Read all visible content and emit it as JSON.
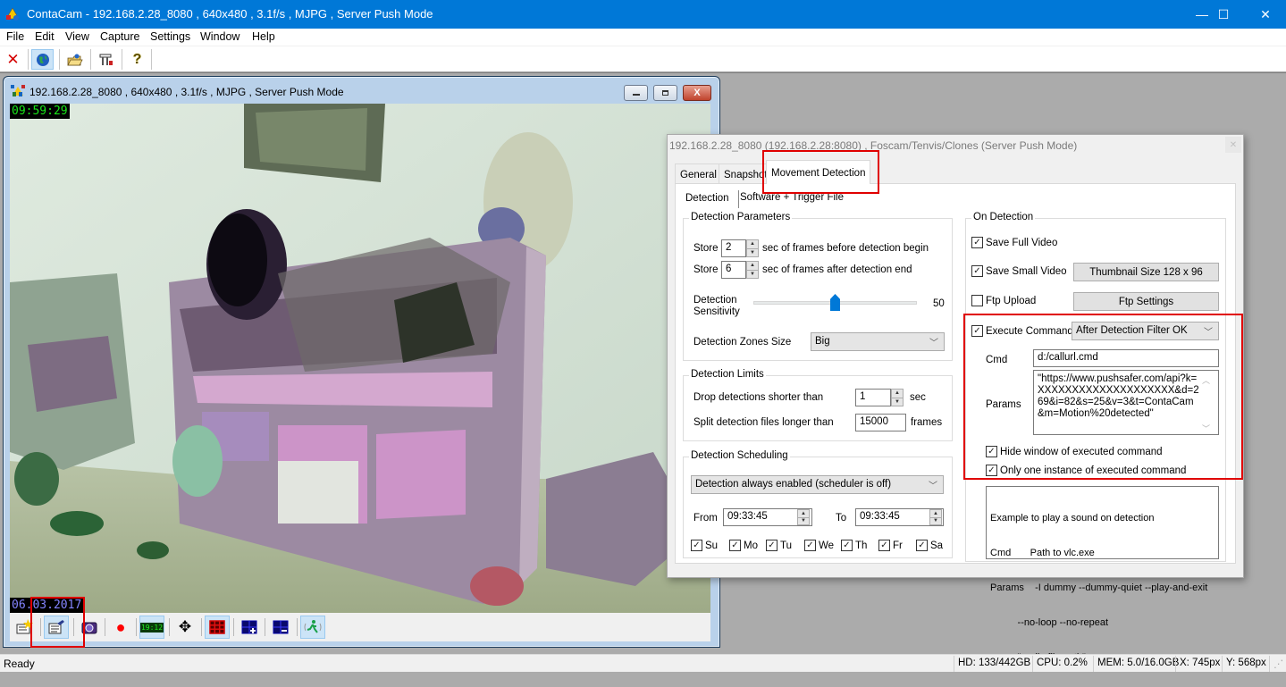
{
  "window": {
    "title": "ContaCam - 192.168.2.28_8080 , 640x480 , 3.1f/s , MJPG , Server Push Mode",
    "controls": {
      "minimize": "—",
      "maximize": "☐",
      "close": "✕"
    }
  },
  "menu": [
    "File",
    "Edit",
    "View",
    "Capture",
    "Settings",
    "Window",
    "Help"
  ],
  "toolbar": [
    {
      "icon": "close-icon",
      "glyph": "✕",
      "color": "#d40000"
    },
    {
      "icon": "globe-icon",
      "glyph": "🌐",
      "active": true
    },
    {
      "icon": "open-folder-icon",
      "glyph": "📂"
    },
    {
      "icon": "network-cameras-icon",
      "glyph": "🖧"
    },
    {
      "icon": "help-icon",
      "glyph": "?"
    }
  ],
  "camera_window": {
    "title": "192.168.2.28_8080 , 640x480 , 3.1f/s , MJPG , Server Push Mode",
    "osd_time": "09:59:29",
    "osd_date": "06.03.2017",
    "toolbar": [
      {
        "icon": "snapshot-wizard-icon",
        "glyph": "✎"
      },
      {
        "icon": "camera-settings-icon",
        "glyph": "🗒",
        "active": true,
        "highlighted": true
      },
      {
        "icon": "camera-snapshot-icon",
        "glyph": "📷"
      },
      {
        "icon": "record-icon",
        "glyph": "●",
        "color": "#ff0000"
      },
      {
        "icon": "timestamp-icon",
        "glyph": "19:12",
        "active": true
      },
      {
        "icon": "fit-window-icon",
        "glyph": "✥"
      },
      {
        "icon": "detection-zones-icon",
        "glyph": "▦",
        "active": true
      },
      {
        "icon": "add-zones-icon",
        "glyph": "+"
      },
      {
        "icon": "remove-zones-icon",
        "glyph": "−"
      },
      {
        "icon": "movement-detection-icon",
        "glyph": "🏃",
        "active": true
      }
    ]
  },
  "dialog": {
    "title": "192.168.2.28_8080 (192.168.2.28:8080) , Foscam/Tenvis/Clones (Server Push Mode)",
    "close_glyph": "✕",
    "tabs": [
      {
        "label": "General",
        "active": false
      },
      {
        "label": "Snapshot",
        "active": false
      },
      {
        "label": "Movement Detection",
        "active": true
      }
    ],
    "detection_label": "Detection",
    "detection_mode": "Software + Trigger File",
    "parameters": {
      "group_title": "Detection Parameters",
      "store_label": "Store",
      "store_before": "2",
      "store_before_suffix": "sec of frames before detection begin",
      "store_after": "6",
      "store_after_suffix": "sec of frames after detection end",
      "sensitivity_label_1": "Detection",
      "sensitivity_label_2": "Sensitivity",
      "sensitivity_value": "50",
      "sensitivity_min": 0,
      "sensitivity_max": 100,
      "zones_size_label": "Detection Zones Size",
      "zones_size_value": "Big"
    },
    "limits": {
      "group_title": "Detection Limits",
      "drop_label": "Drop detections shorter than",
      "drop_value": "1",
      "drop_unit": "sec",
      "split_label": "Split detection files longer than",
      "split_value": "15000",
      "split_unit": "frames"
    },
    "scheduling": {
      "group_title": "Detection Scheduling",
      "mode": "Detection always enabled (scheduler is off)",
      "from_label": "From",
      "from_value": "09:33:45",
      "to_label": "To",
      "to_value": "09:33:45",
      "days": [
        {
          "label": "Su",
          "checked": true
        },
        {
          "label": "Mo",
          "checked": true
        },
        {
          "label": "Tu",
          "checked": true
        },
        {
          "label": "We",
          "checked": true
        },
        {
          "label": "Th",
          "checked": true
        },
        {
          "label": "Fr",
          "checked": true
        },
        {
          "label": "Sa",
          "checked": true
        }
      ]
    },
    "on_detection": {
      "group_title": "On Detection",
      "save_full_video": {
        "label": "Save Full Video",
        "checked": true
      },
      "save_small_video": {
        "label": "Save Small Video",
        "checked": true
      },
      "thumbnail_button": "Thumbnail Size 128 x 96",
      "ftp_upload": {
        "label": "Ftp Upload",
        "checked": false
      },
      "ftp_settings_button": "Ftp Settings",
      "execute_command": {
        "label": "Execute Command",
        "checked": true
      },
      "execute_when": "After Detection Filter OK",
      "cmd_label": "Cmd",
      "cmd_value": "d:/callurl.cmd",
      "params_label": "Params",
      "params_value": "\"https://www.pushsafer.com/api?k=XXXXXXXXXXXXXXXXXXXX&d=269&i=82&s=25&v=3&t=ContaCam&m=Motion%20detected\"",
      "hide_window": {
        "label": "Hide window of executed command",
        "checked": true
      },
      "one_instance": {
        "label": "Only one instance of executed command",
        "checked": true
      },
      "example_lines": [
        "Example to play a sound on detection",
        "Cmd       Path to vlc.exe",
        "Params    -I dummy --dummy-quiet --play-and-exit",
        "          --no-loop --no-repeat",
        "          \"audio file path\""
      ]
    }
  },
  "status": {
    "ready": "Ready",
    "hd": "HD: 133/442GB",
    "cpu": "CPU: 0.2%",
    "mem": "MEM: 5.0/16.0GB",
    "x": "X: 745px",
    "y": "Y: 568px"
  },
  "highlight_color": "#e00000",
  "accent_color": "#0078d7"
}
